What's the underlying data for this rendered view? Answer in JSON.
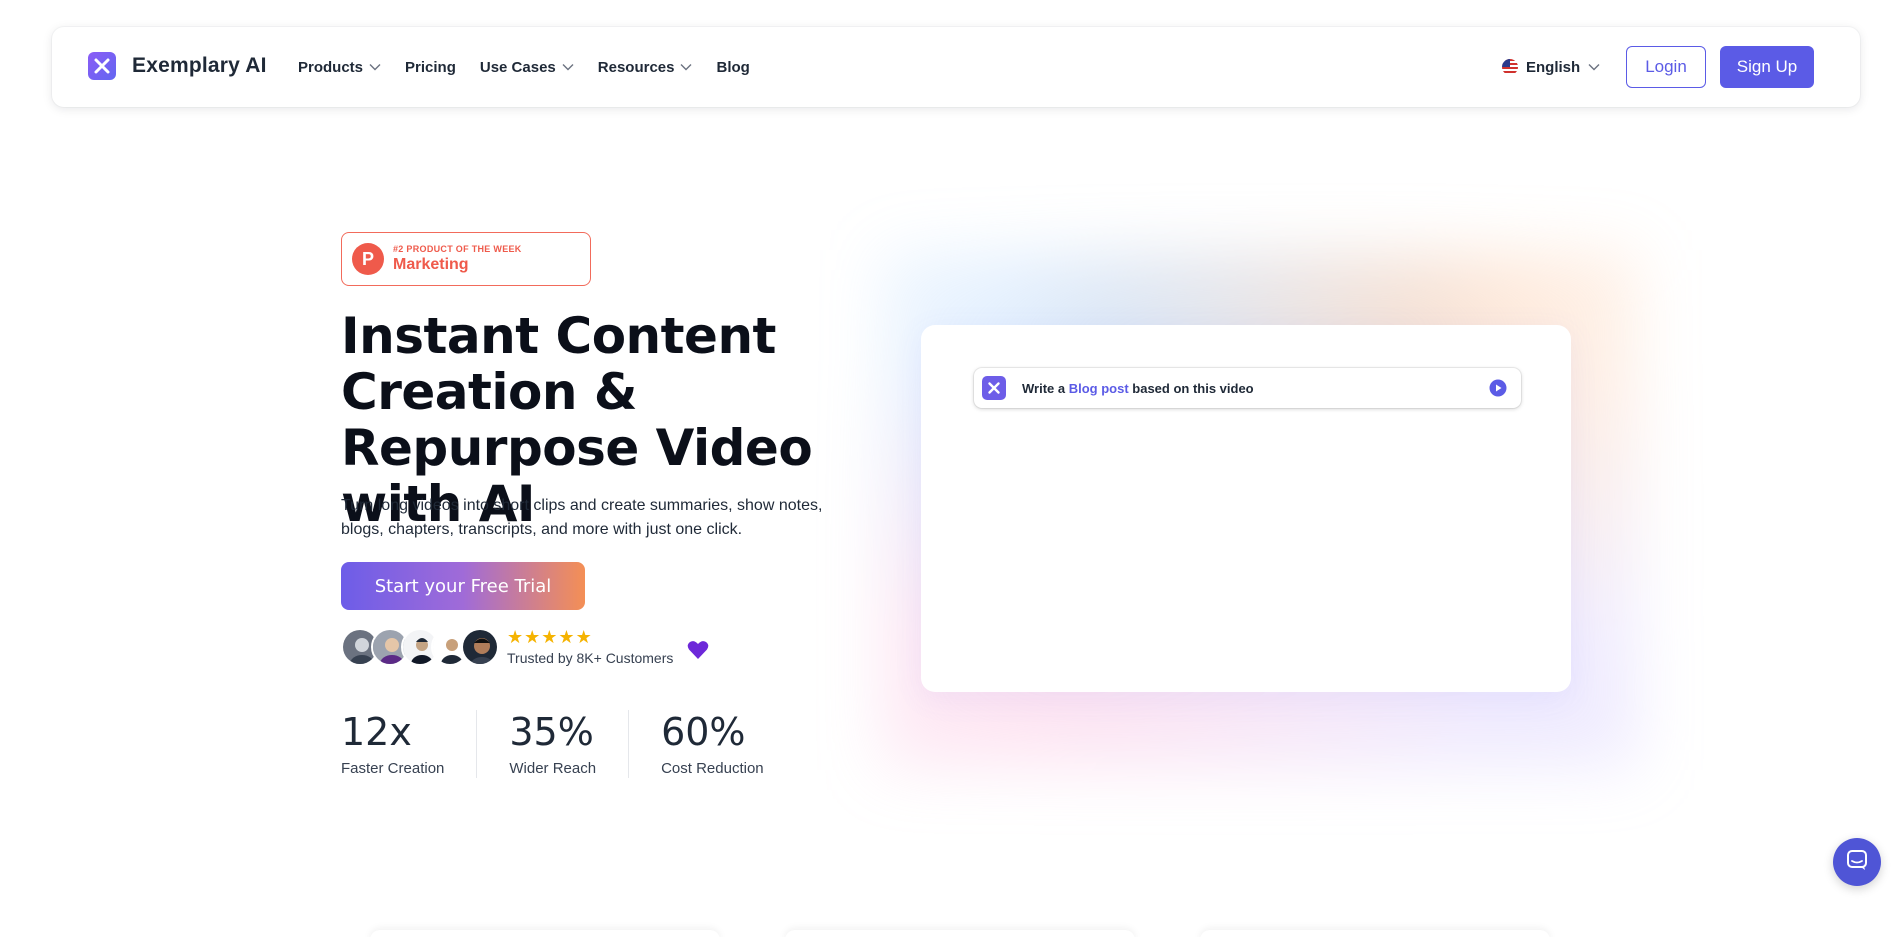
{
  "brand": {
    "name": "Exemplary AI"
  },
  "nav": {
    "items": [
      {
        "label": "Products",
        "has_dropdown": true
      },
      {
        "label": "Pricing",
        "has_dropdown": false
      },
      {
        "label": "Use Cases",
        "has_dropdown": true
      },
      {
        "label": "Resources",
        "has_dropdown": true
      },
      {
        "label": "Blog",
        "has_dropdown": false
      }
    ],
    "language": "English",
    "login_label": "Login",
    "signup_label": "Sign Up"
  },
  "hero": {
    "badge": {
      "kicker": "#2 PRODUCT OF THE WEEK",
      "title": "Marketing",
      "icon_letter": "P"
    },
    "title": "Instant Content Creation & Repurpose Video with AI",
    "subtitle": "Turn long videos into short clips and create summaries, show notes, blogs, chapters, transcripts, and more with just one click.",
    "cta_label": "Start your Free Trial",
    "rating_stars": 5,
    "trusted_text": "Trusted by 8K+ Customers",
    "stats": [
      {
        "value": "12x",
        "label": "Faster Creation"
      },
      {
        "value": "35%",
        "label": "Wider Reach"
      },
      {
        "value": "60%",
        "label": "Cost Reduction"
      }
    ]
  },
  "preview": {
    "prompt_prefix": "Write a ",
    "prompt_highlight": "Blog post",
    "prompt_suffix": " based on this video"
  },
  "colors": {
    "accent": "#5b5be6",
    "producthunt": "#ef5a4b",
    "star": "#f5b301",
    "cta_gradient_start": "#6d5de8",
    "cta_gradient_end": "#f48f55"
  }
}
